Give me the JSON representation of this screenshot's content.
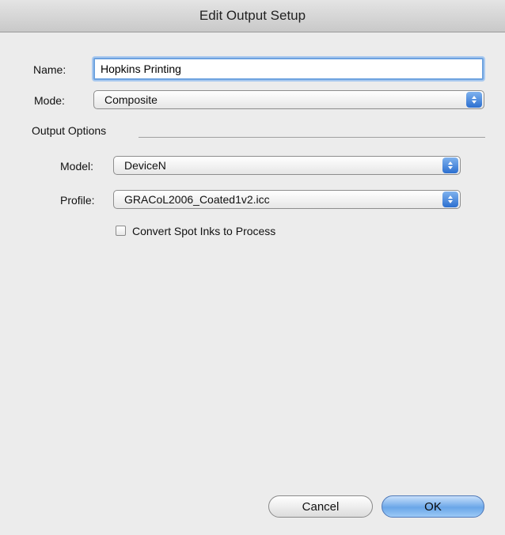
{
  "window": {
    "title": "Edit Output Setup"
  },
  "form": {
    "name_label": "Name:",
    "name_value": "Hopkins Printing",
    "mode_label": "Mode:",
    "mode_value": "Composite"
  },
  "output_options": {
    "group_label": "Output Options",
    "model_label": "Model:",
    "model_value": "DeviceN",
    "profile_label": "Profile:",
    "profile_value": "GRACoL2006_Coated1v2.icc",
    "convert_spot_label": "Convert Spot Inks to Process",
    "convert_spot_checked": false
  },
  "buttons": {
    "cancel_label": "Cancel",
    "ok_label": "OK"
  },
  "icons": {
    "popup_arrows": "up-down-arrows-icon"
  },
  "colors": {
    "accent": "#6aa6e8",
    "focus_ring": "#6da2df"
  }
}
